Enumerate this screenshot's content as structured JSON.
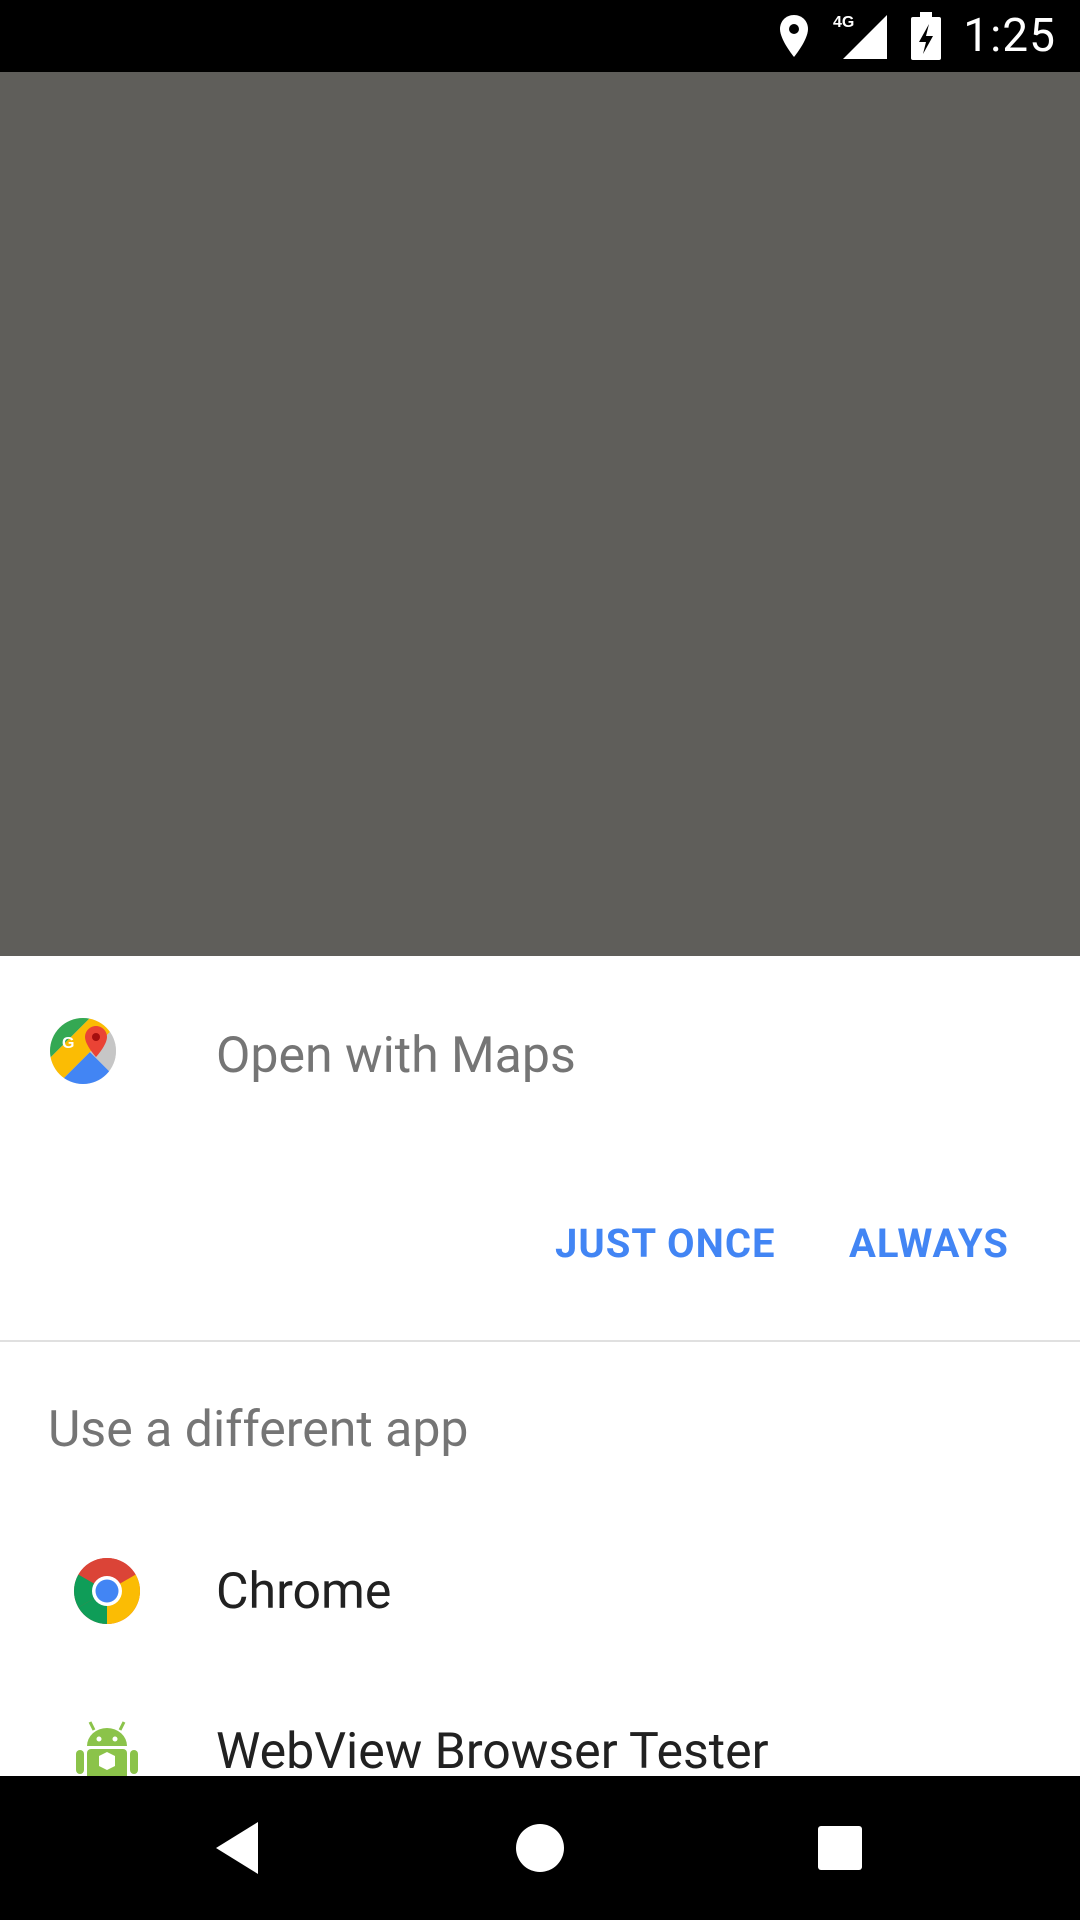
{
  "status_bar": {
    "time": "1:25",
    "network": "4G",
    "icons": [
      "location-icon",
      "signal-icon",
      "battery-charging-icon"
    ]
  },
  "dialog": {
    "title": "Open with Maps",
    "app_icon": "google-maps-icon",
    "buttons": {
      "just_once": "JUST ONCE",
      "always": "ALWAYS"
    },
    "alt_header": "Use a different app",
    "apps": [
      {
        "label": "Chrome",
        "icon": "chrome-icon"
      },
      {
        "label": "WebView Browser Tester",
        "icon": "android-icon"
      }
    ]
  },
  "nav_bar": {
    "icons": [
      "back-icon",
      "home-icon",
      "recents-icon"
    ]
  },
  "colors": {
    "accent": "#4285f4",
    "scrim": "#5f5e5a",
    "secondary_text": "#757575",
    "primary_text": "#212121"
  }
}
